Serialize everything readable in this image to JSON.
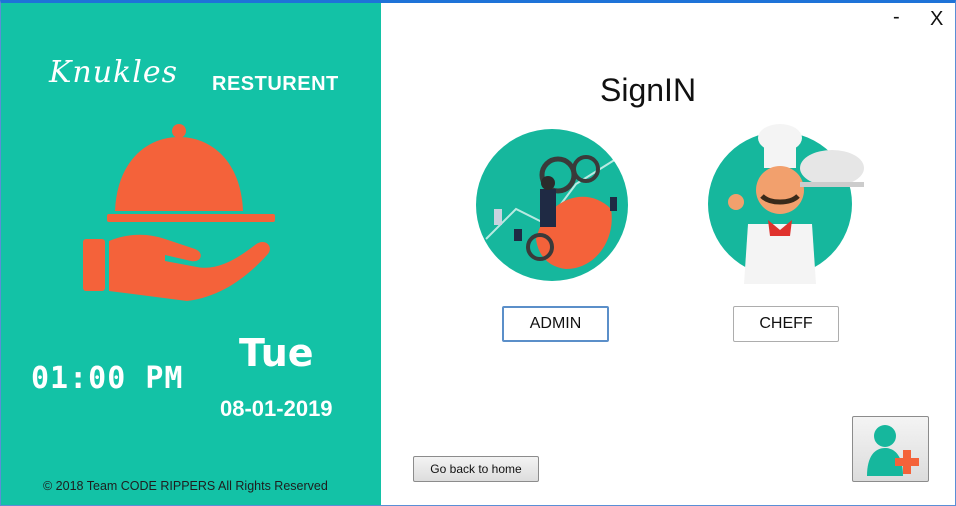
{
  "window": {
    "minimize_label": "-",
    "close_label": "X"
  },
  "brand": {
    "script_name": "Knukles",
    "word": "RESTURENT"
  },
  "clock": {
    "time": "01:00 PM",
    "day": "Tue",
    "date": "08-01-2019"
  },
  "footer": {
    "copyright": "© 2018 Team CODE RIPPERS All Rights Reserved"
  },
  "signin": {
    "title": "SignIN",
    "admin_label": "ADMIN",
    "cheff_label": "CHEFF",
    "home_label": "Go back to home"
  },
  "colors": {
    "panel": "#13c2a6",
    "cloche": "#f4623a",
    "accent_teal": "#16b79d"
  },
  "icons": {
    "cloche": "serving-cloche-icon",
    "admin": "admin-illustration-icon",
    "chef": "chef-illustration-icon",
    "add_user": "add-user-icon"
  }
}
